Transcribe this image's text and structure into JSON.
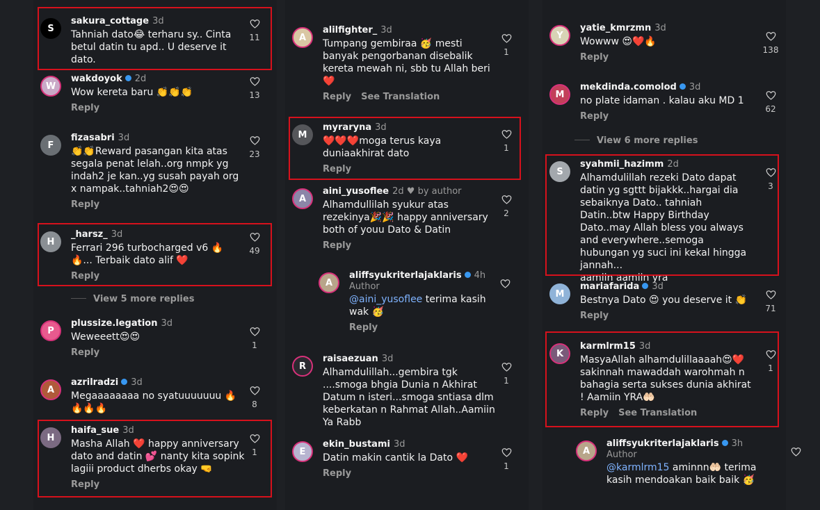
{
  "col1": [
    {
      "user": "sakura_cottage",
      "time": "3d",
      "text": "Tahniah dato😂  terharu sy.. Cinta betul datin tu apd.. U deserve it dato.",
      "likes": "11",
      "avatar": "S",
      "avatar_color": "#000000"
    },
    {
      "user": "wakdoyok",
      "time": "2d",
      "text": "Wow kereta baru 👏👏👏",
      "likes": "13",
      "reply": "Reply",
      "avatar": "W",
      "avatar_color": "#c9a9c7"
    },
    {
      "user": "fizasabri",
      "time": "3d",
      "text": "👏👏Reward pasangan kita atas segala penat lelah..org nmpk yg indah2 je kan..yg susah payah org x nampak..tahniah2😍😍",
      "likes": "23",
      "reply": "Reply",
      "avatar": "F",
      "avatar_color": "#6a6f74"
    },
    {
      "user": "_harsz_",
      "time": "3d",
      "text": "Ferrari 296 turbocharged v6 🔥\n🔥... Terbaik dato alif ❤️",
      "likes": "49",
      "reply": "Reply",
      "avatar": "H",
      "avatar_color": "#8a8f94"
    },
    {
      "more": "View 5 more replies"
    },
    {
      "user": "plussize.legation",
      "time": "3d",
      "text": "Weweeett😍😍",
      "likes": "1",
      "reply": "Reply",
      "avatar": "P",
      "avatar_color": "#e85a8e"
    },
    {
      "user": "azrilradzi",
      "time": "3d",
      "text": "Megaaaaaaaa no syatuuuuuuu 🔥\n🔥🔥🔥",
      "likes": "8",
      "reply": "Reply",
      "avatar": "A",
      "avatar_color": "#b05a3a"
    },
    {
      "user": "haifa_sue",
      "time": "3d",
      "text": "Masha Allah ❤️  happy anniversary dato and datin 💕  nanty kita sopink lagiii product dherbs okay 🤜",
      "likes": "1",
      "reply": "Reply",
      "avatar": "H",
      "avatar_color": "#7b6a82"
    }
  ],
  "col2": [
    {
      "user": "alilfighter_",
      "time": "3d",
      "text": "Tumpang gembiraa 🥳  mesti banyak pengorbanan disebalik kereta mewah ni, sbb tu Allah beri ❤️",
      "likes": "1",
      "reply": "Reply",
      "translate": "See Translation",
      "avatar": "A",
      "avatar_color": "#d9c7a3"
    },
    {
      "user": "myraryna",
      "time": "3d",
      "text": "❤️❤️❤️moga terus kaya duniaakhirat dato",
      "likes": "1",
      "reply": "Reply",
      "avatar": "M",
      "avatar_color": "#55565a"
    },
    {
      "user": "aini_yusoflee",
      "time": "2d",
      "author_like": "♥ by author",
      "text": "Alhamdullilah syukur atas rezekinya🎉🎉  happy anniversary both of youu Dato & Datin",
      "likes": "2",
      "reply": "Reply",
      "avatar": "A",
      "avatar_color": "#8c86a8"
    },
    {
      "user": "aliffsyukriterlajaklaris",
      "time": "4h",
      "author": "Author",
      "mention": "@aini_yusoflee",
      "text": " terima kasih wak 🥳",
      "reply": "Reply",
      "avatar": "A",
      "avatar_color": "#b8a58a"
    },
    {
      "user": "raisaezuan",
      "time": "3d",
      "text": "Alhamdulillah...gembira tgk ....smoga bhgia Dunia n Akhirat Datum n isteri...smoga sntiasa dlm keberkatan n Rahmat Allah..Aamiin Ya Rabb",
      "likes": "1",
      "avatar": "R",
      "avatar_color": "#2a2a30"
    },
    {
      "user": "ekin_bustami",
      "time": "3d",
      "text": "Datin makin cantik la Dato ❤️",
      "likes": "1",
      "reply": "Reply",
      "avatar": "E",
      "avatar_color": "#b7b4d0"
    }
  ],
  "col3": [
    {
      "user": "yatie_kmrzmn",
      "time": "3d",
      "text": "Wowww 😍❤️🔥",
      "likes": "138",
      "reply": "Reply",
      "avatar": "Y",
      "avatar_color": "#d8d3b5"
    },
    {
      "user": "mekdinda.comolod",
      "time": "3d",
      "text": "no plate idaman . kalau aku MD 1",
      "likes": "62",
      "reply": "Reply",
      "avatar": "M",
      "avatar_color": "#c2405a"
    },
    {
      "more": "View 6 more replies"
    },
    {
      "user": "syahmii_hazimm",
      "time": "2d",
      "text": "Alhamdulillah rezeki Dato dapat datin yg sgttt bijakkk..hargai dia sebaiknya Dato.. tahniah Datin..btw Happy Birthday Dato..may Allah bless you always and everywhere..semoga hubungan yg suci ini kekal hingga jannah...\naamiin aamiin yra",
      "likes": "3",
      "avatar": "S",
      "avatar_color": "#a3a8ad"
    },
    {
      "user": "mariafarida",
      "time": "3d",
      "text": "Bestnya Dato 😍  you deserve it 👏",
      "likes": "71",
      "reply": "Reply",
      "avatar": "M",
      "avatar_color": "#8fb3d8"
    },
    {
      "user": "karmlrm15",
      "time": "3d",
      "text": "MasyaAllah alhamdulillaaaah😍❤️ sakinnah mawaddah warohmah n bahagia serta sukses dunia akhirat ! Aamiin YRA🤲🏻",
      "likes": "1",
      "reply": "Reply",
      "translate": "See Translation",
      "avatar": "K",
      "avatar_color": "#7a5a7a"
    },
    {
      "user": "aliffsyukriterlajaklaris",
      "time": "3h",
      "author": "Author",
      "mention": "@karmlrm15",
      "text": " aminnn🤲🏻 terima kasih mendoakan baik baik 🥳",
      "avatar": "A",
      "avatar_color": "#b8a58a"
    }
  ]
}
